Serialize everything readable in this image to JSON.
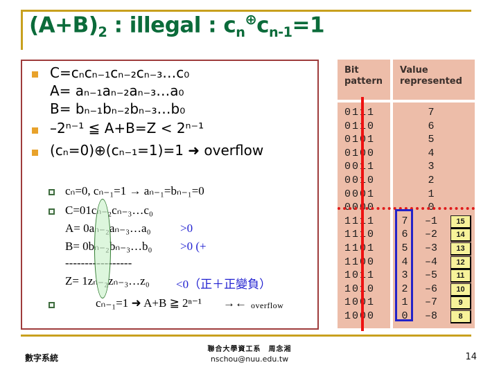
{
  "slide": {
    "title_main": "(A+B)",
    "title_sub": "2",
    "title_rest_a": " : illegal : c",
    "title_sub_n": "n",
    "title_op": "⊕",
    "title_c2": "c",
    "title_sub_n1": "n-1",
    "title_eq": "=1",
    "accent_gold": "#c8a01e",
    "accent_green": "#0b6b3a",
    "box_border": "#9e3b3b"
  },
  "content": {
    "line_C_pre": "C=c",
    "line_C": "C=cₙcₙ₋₁cₙ₋₂cₙ₋₃…c₀",
    "line_A": "A=   aₙ₋₁aₙ₋₂aₙ₋₃…a₀",
    "line_B": "B=   bₙ₋₁bₙ₋₂bₙ₋₃…b₀",
    "line_range": "–2ⁿ⁻¹ ≦ A+B=Z < 2ⁿ⁻¹",
    "line_xor": "(cₙ=0)⊕(cₙ₋₁=1)=1 ➜ overflow",
    "sub1": "cₙ=0, cₙ₋₁=1 → aₙ₋₁=bₙ₋₁=0",
    "sub2_C": "C=01cₙ₋₂cₙ₋₃…c₀",
    "sub2_A": "A=  0aₙ₋₂aₙ₋₃…a₀",
    "sub2_A_tag": ">0",
    "sub2_B": "B=  0bₙ₋₂bₙ₋₃…b₀",
    "sub2_B_tag": ">0 (+",
    "sub2_dashes": "-----------------",
    "sub2_Z": "Z=  1zₙ₋₂zₙ₋₃…z₀",
    "sub2_Z_tag": "<0（正＋正變負）",
    "sub3": "cₙ₋₁=1 ➜ A+B ≧ 2ⁿ⁻¹",
    "sub3_arrows": "→←",
    "sub3_overflow": "overflow"
  },
  "table": {
    "header": [
      "Bit pattern",
      "Value represented"
    ],
    "header_bit_l1": "Bit",
    "header_bit_l2": "pattern",
    "header_val_l1": "Value",
    "header_val_l2": "represented",
    "bg_color": "#edbda9",
    "rows": [
      {
        "bits": "0111",
        "mag": "",
        "value": "7",
        "yellow": ""
      },
      {
        "bits": "0110",
        "mag": "",
        "value": "6",
        "yellow": ""
      },
      {
        "bits": "0101",
        "mag": "",
        "value": "5",
        "yellow": ""
      },
      {
        "bits": "0100",
        "mag": "",
        "value": "4",
        "yellow": ""
      },
      {
        "bits": "0011",
        "mag": "",
        "value": "3",
        "yellow": ""
      },
      {
        "bits": "0010",
        "mag": "",
        "value": "2",
        "yellow": ""
      },
      {
        "bits": "0001",
        "mag": "",
        "value": "1",
        "yellow": ""
      },
      {
        "bits": "0000",
        "mag": "",
        "value": "0",
        "yellow": ""
      },
      {
        "bits": "1111",
        "mag": "7",
        "value": "–1",
        "yellow": "15"
      },
      {
        "bits": "1110",
        "mag": "6",
        "value": "–2",
        "yellow": "14"
      },
      {
        "bits": "1101",
        "mag": "5",
        "value": "–3",
        "yellow": "13"
      },
      {
        "bits": "1100",
        "mag": "4",
        "value": "–4",
        "yellow": "12"
      },
      {
        "bits": "1011",
        "mag": "3",
        "value": "–5",
        "yellow": "11"
      },
      {
        "bits": "1010",
        "mag": "2",
        "value": "–6",
        "yellow": "10"
      },
      {
        "bits": "1001",
        "mag": "1",
        "value": "–7",
        "yellow": "9"
      },
      {
        "bits": "1000",
        "mag": "0",
        "value": "–8",
        "yellow": "8"
      }
    ],
    "marker_colors": {
      "red_line": "#ee1111",
      "red_dotted": "#e01b1b",
      "blue_box": "#2222c8",
      "yellow_box": "#f7f29a"
    }
  },
  "footer": {
    "left": "數字系統",
    "center_cn": "聯合大學資工系　周念湘",
    "center_mail": "nschou@nuu.edu.tw",
    "page": "14"
  }
}
